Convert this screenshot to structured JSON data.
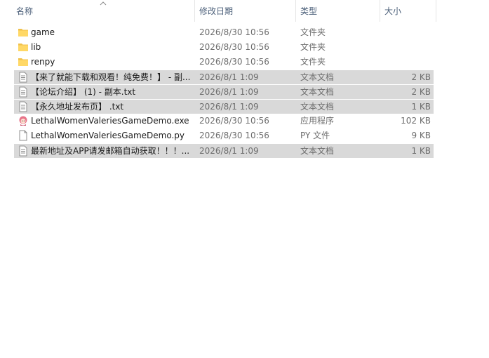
{
  "header": {
    "name": "名称",
    "date": "修改日期",
    "type": "类型",
    "size": "大小"
  },
  "files": [
    {
      "name": "game",
      "date": "2026/8/30 10:56",
      "type": "文件夹",
      "size": "",
      "icon": "folder-icon",
      "selected": false
    },
    {
      "name": "lib",
      "date": "2026/8/30 10:56",
      "type": "文件夹",
      "size": "",
      "icon": "folder-icon",
      "selected": false
    },
    {
      "name": "renpy",
      "date": "2026/8/30 10:56",
      "type": "文件夹",
      "size": "",
      "icon": "folder-icon",
      "selected": false
    },
    {
      "name": "【来了就能下载和观看！纯免费！】 - 副...",
      "date": "2026/8/1 1:09",
      "type": "文本文档",
      "size": "2 KB",
      "icon": "text-file-icon",
      "selected": true
    },
    {
      "name": "【论坛介绍】 (1) - 副本.txt",
      "date": "2026/8/1 1:09",
      "type": "文本文档",
      "size": "2 KB",
      "icon": "text-file-icon",
      "selected": true
    },
    {
      "name": "【永久地址发布页】 .txt",
      "date": "2026/8/1 1:09",
      "type": "文本文档",
      "size": "1 KB",
      "icon": "text-file-icon",
      "selected": true
    },
    {
      "name": "LethalWomenValeriesGameDemo.exe",
      "date": "2026/8/30 10:56",
      "type": "应用程序",
      "size": "102 KB",
      "icon": "exe-app-icon",
      "selected": false
    },
    {
      "name": "LethalWomenValeriesGameDemo.py",
      "date": "2026/8/30 10:56",
      "type": "PY 文件",
      "size": "9 KB",
      "icon": "blank-file-icon",
      "selected": false
    },
    {
      "name": "最新地址及APP请发邮箱自动获取！！！...",
      "date": "2026/8/1 1:09",
      "type": "文本文档",
      "size": "1 KB",
      "icon": "text-file-icon",
      "selected": true
    }
  ]
}
